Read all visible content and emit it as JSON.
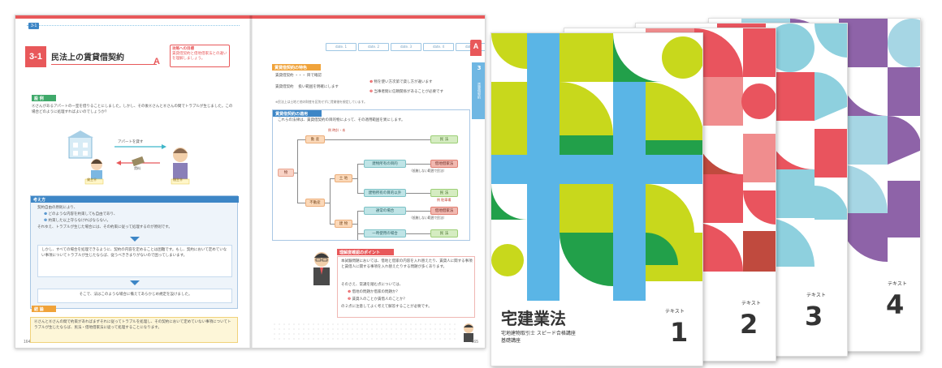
{
  "spread": {
    "header_chip": "3-1",
    "section_number": "3-1",
    "section_title": "民法上の賃貸借契約",
    "section_mark": "A",
    "goal_label": "攻略への目標",
    "goal_text": "賃貸借契約と借地借家法との違いを理解しましょう。",
    "tabs": [
      "date. 1",
      "date. 2",
      "date. 3",
      "date. 4",
      "date. 5"
    ],
    "a_badge": "A",
    "side_tab_number": "3",
    "side_tab_text": "賃貸借契約",
    "case_header": "設 例",
    "case_text": "Ⓐさんがあるアパートの一室を借りることにしました。しかし、その後ⒶさんとⒷさんの間でトラブルが生じました。この場合どのように処理すればよいのでしょうか？",
    "illus_caption": "アパートを貸す",
    "illus_money": "賃料",
    "tenant_label": "貸主Ⓐ",
    "landlord_label": "借主Ⓑ",
    "think_header": "考え方",
    "think_p1": "契約自由の原則により、",
    "think_li1": "どのような内容を約束しても自由であり、",
    "think_li2": "約束した以上守らなければならない。",
    "think_p2": "それゆえ、トラブルが生じた場合には、その約束に従って処理するのが原則です。",
    "think_p3": "しかし、すべての場合を処理できるように、契約の内容を定めることは困難です。もし、契約において定めていない事項についてトラブルが生じたならば、従うべききまりがないので困ってしまいます。",
    "think_p4": "そこで、法はこのような場合に備えてあらかじめ規定を設けました。",
    "concl_header": "結 論",
    "concl_text": "ⒶさんとⒷさんの間で約束があればまずそれに従ってトラブルを処理し、その契約において定めていない事項についてトラブルが生じたならば、民法・借地借家法に従って処理することになります。",
    "page_left": "164",
    "page_right": "165",
    "rbox1_header": "賃貸借契約の特色",
    "rbox1_l1": "賃貸借契約 ・・・ 目で確認",
    "rbox1_l2": "賃貸借契約　 扱い範囲を明確にします",
    "rbox1_b1": "物を使い方次第で貸し方が違います",
    "rbox1_b2": "当事者間に信頼関係があることが必要です",
    "rbox1_note": "※民法上は土地と他の財産を区別せずに賃貸借を規定しています。",
    "rbox2_header": "賃貸借契約の適用",
    "rbox2_intro": "これらの法律は、賃貸借契約の目的物によって、その適用範囲を異にします。",
    "tree_root": "物",
    "tree_movable": "動 産",
    "tree_immovable": "不動産",
    "tree_land": "土 地",
    "tree_building": "建 物",
    "tree_n1": "建物所有の目的",
    "tree_n2": "建物所有の目的以外",
    "tree_n3": "通常の場合",
    "tree_n4": "一時使用の場合",
    "tree_law_civil": "民 法",
    "tree_law_special1": "借地借家法",
    "tree_law_special2": "借地借家法",
    "tree_note1": "（抵触しない範囲で民法）",
    "tree_note2": "（抵触しない範囲で民法）",
    "tree_ex_movable": "例 時計・本",
    "tree_ex_parking": "例 駐車場",
    "point_header": "理解度確認のポイント",
    "point_text": "本試験問題においては、借地と借家の内容を入れ替えたり、賃貸人に関する事項と賃借人に関する事項を入れ替えたりする問題が多くあります。",
    "point_sub": "そのさえ、常識を踏む点については、",
    "point_q1": "借地の問題か借家の問題か？",
    "point_q2": "賃貸人のことか賃借人のことか？",
    "point_end": "の２点に注意してよく考えて解答することが必要です。"
  },
  "covers": [
    {
      "index": 1,
      "title": "宅建業法",
      "series": "テキスト",
      "number": "1",
      "sub1": "宅地建物取引士 スピード合格講座",
      "sub2": "基礎講座",
      "colors": [
        "#5ab5e6",
        "#c8d81c",
        "#22a04a"
      ]
    },
    {
      "index": 2,
      "series": "テキスト",
      "number": "2",
      "colors": [
        "#e9545e",
        "#f08d8e",
        "#c04a3e"
      ]
    },
    {
      "index": 3,
      "series": "テキスト",
      "number": "3",
      "colors": [
        "#8ed0de",
        "#e9545e",
        "#c8d81c"
      ]
    },
    {
      "index": 4,
      "series": "テキスト",
      "number": "4",
      "colors": [
        "#8e63a8",
        "#a6d6e4",
        "#c8d81c"
      ]
    }
  ]
}
